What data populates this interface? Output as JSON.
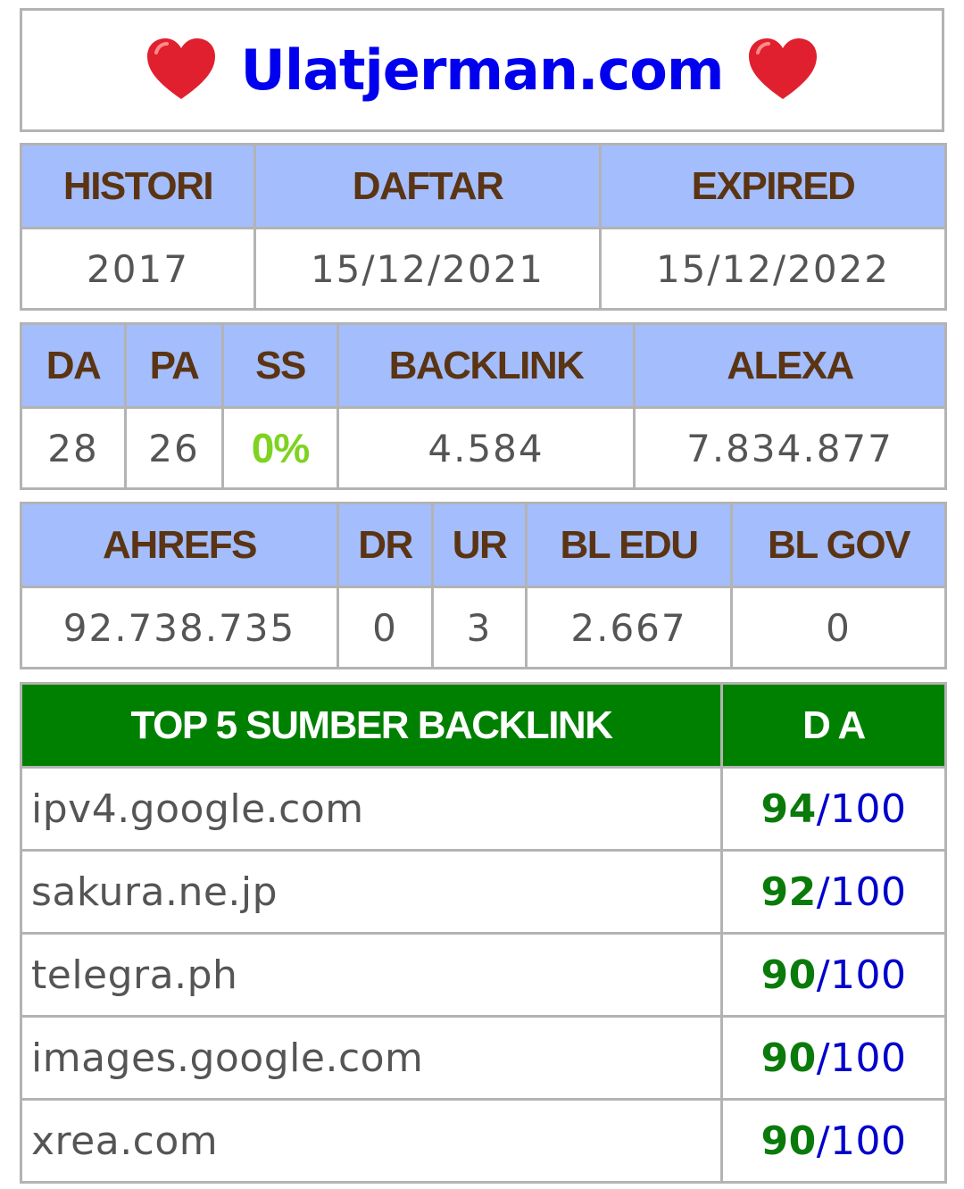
{
  "title": "Ulatjerman.com",
  "icons": {
    "left": "heart-icon",
    "right": "heart-icon"
  },
  "colors": {
    "header_bg": "#a4bdfc",
    "header_text": "#5a3413",
    "title": "#0000ee",
    "ss_value": "#7ed321",
    "top_header_bg": "#008000",
    "da_score": "#0a7a0a",
    "da_max": "#0000cc"
  },
  "table1": {
    "headers": [
      "HISTORI",
      "DAFTAR",
      "EXPIRED"
    ],
    "values": [
      "2017",
      "15/12/2021",
      "15/12/2022"
    ]
  },
  "table2": {
    "headers": [
      "DA",
      "PA",
      "SS",
      "BACKLINK",
      "ALEXA"
    ],
    "values": [
      "28",
      "26",
      "0%",
      "4.584",
      "7.834.877"
    ]
  },
  "table3": {
    "headers": [
      "AHREFS",
      "DR",
      "UR",
      "BL EDU",
      "BL GOV"
    ],
    "values": [
      "92.738.735",
      "0",
      "3",
      "2.667",
      "0"
    ]
  },
  "top": {
    "header_site": "TOP 5 SUMBER BACKLINK",
    "header_da": "D A",
    "rows": [
      {
        "site": "ipv4.google.com",
        "da": "94",
        "max": "/100"
      },
      {
        "site": "sakura.ne.jp",
        "da": "92",
        "max": "/100"
      },
      {
        "site": "telegra.ph",
        "da": "90",
        "max": "/100"
      },
      {
        "site": "images.google.com",
        "da": "90",
        "max": "/100"
      },
      {
        "site": "xrea.com",
        "da": "90",
        "max": "/100"
      }
    ]
  }
}
